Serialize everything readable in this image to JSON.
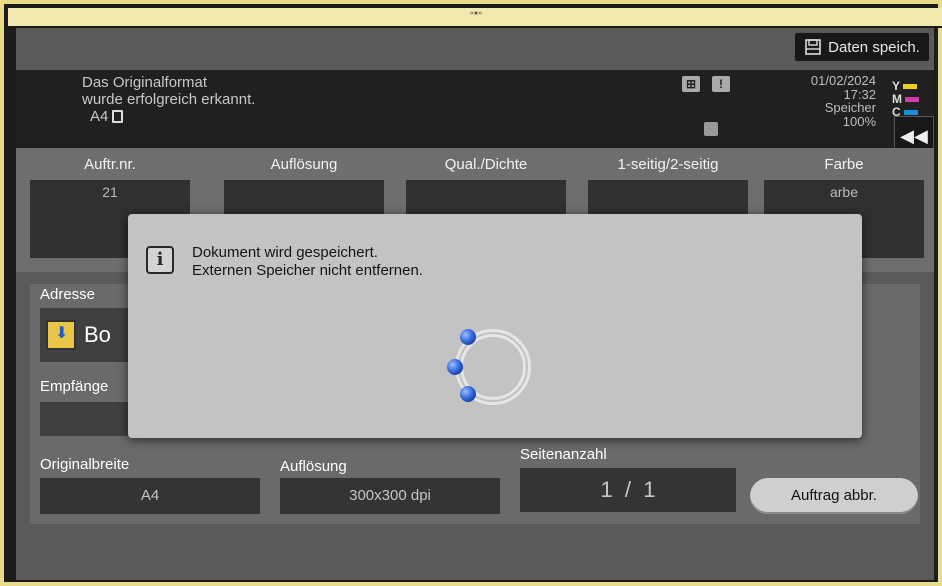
{
  "header": {
    "save_label": "Daten speich."
  },
  "status": {
    "message_line1": "Das Originalformat",
    "message_line2": "wurde erfolgreich erkannt.",
    "paper_format": "A4",
    "date": "01/02/2024",
    "time": "17:32",
    "memory_label": "Speicher",
    "memory_value": "100%",
    "toner": [
      {
        "letter": "Y",
        "color": "#e6d21e"
      },
      {
        "letter": "M",
        "color": "#d23aa8"
      },
      {
        "letter": "C",
        "color": "#1a8ed8"
      }
    ]
  },
  "job_table": {
    "columns": [
      {
        "header": "Auftr.nr.",
        "value": "21"
      },
      {
        "header": "Auflösung",
        "value": ""
      },
      {
        "header": "Qual./Dichte",
        "value": ""
      },
      {
        "header": "1-seitig/2-seitig",
        "value": ""
      },
      {
        "header": "Farbe",
        "value": "arbe"
      }
    ]
  },
  "destination": {
    "address_label": "Adresse",
    "address_value": "Bo",
    "recipient_label": "Empfänge"
  },
  "bottom": {
    "original_width_label": "Originalbreite",
    "original_width_value": "A4",
    "resolution_label": "Auflösung",
    "resolution_value": "300x300 dpi",
    "page_count_label": "Seitenanzahl",
    "page_count_value": "1  /  1",
    "cancel_label": "Auftrag abbr."
  },
  "dialog": {
    "line1": "Dokument wird gespeichert.",
    "line2": "Externen Speicher nicht entfernen.",
    "icon": "info-icon"
  }
}
